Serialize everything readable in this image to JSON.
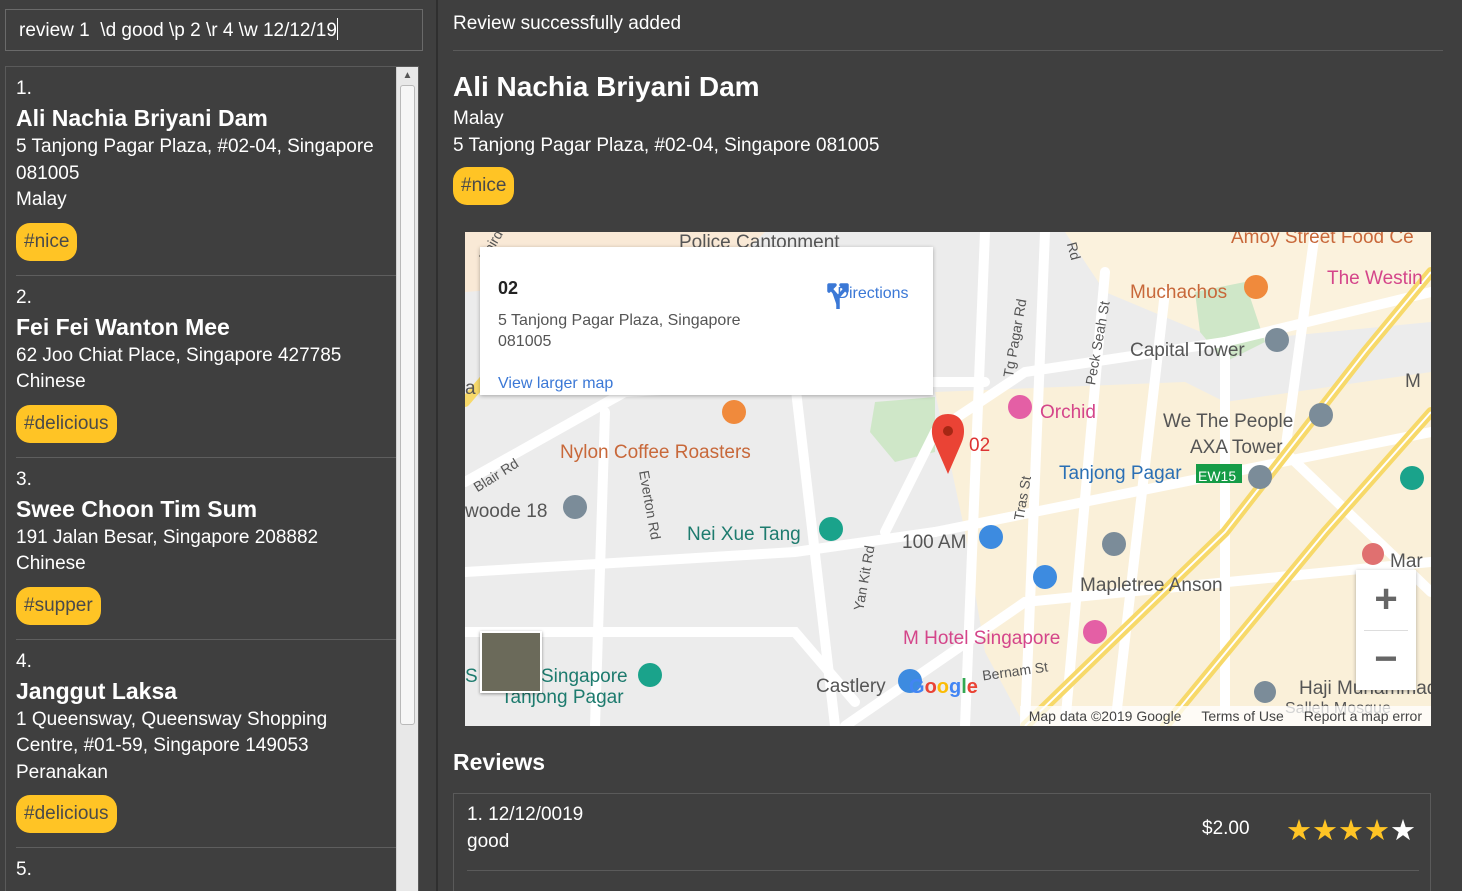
{
  "command_input": {
    "value": "review 1  \\d good \\p 2 \\r 4 \\w 12/12/19"
  },
  "restaurants": [
    {
      "index": "1.",
      "name": "Ali Nachia Briyani Dam",
      "address": "5 Tanjong Pagar Plaza, #02-04, Singapore 081005",
      "address_lines": [
        "5 Tanjong Pagar Plaza, #02-04, Singapore",
        "081005"
      ],
      "cuisine": "Malay",
      "tag": "#nice"
    },
    {
      "index": "2.",
      "name": "Fei Fei Wanton Mee",
      "address": "62 Joo Chiat Place, Singapore 427785",
      "address_lines": [
        "62 Joo Chiat Place, Singapore 427785"
      ],
      "cuisine": "Chinese",
      "tag": "#delicious"
    },
    {
      "index": "3.",
      "name": "Swee Choon Tim Sum",
      "address": "191 Jalan Besar, Singapore 208882",
      "address_lines": [
        "191 Jalan Besar, Singapore 208882"
      ],
      "cuisine": "Chinese",
      "tag": "#supper"
    },
    {
      "index": "4.",
      "name": "Janggut Laksa",
      "address": "1 Queensway, Queensway Shopping Centre, #01-59, Singapore 149053",
      "address_lines": [
        "1 Queensway, Queensway Shopping",
        "Centre, #01-59, Singapore 149053"
      ],
      "cuisine": "Peranakan",
      "tag": "#delicious"
    },
    {
      "index": "5.",
      "name": "",
      "address": "",
      "address_lines": [],
      "cuisine": "",
      "tag": ""
    }
  ],
  "result": {
    "message": "Review successfully added"
  },
  "detail": {
    "name": "Ali Nachia Briyani Dam",
    "cuisine": "Malay",
    "address": "5 Tanjong Pagar Plaza, #02-04, Singapore 081005",
    "tag": "#nice"
  },
  "map": {
    "info_card": {
      "title": "02",
      "address": "5 Tanjong Pagar Plaza, Singapore 081005",
      "directions": "Directions",
      "view_larger": "View larger map"
    },
    "marker_label": "02",
    "labels": {
      "police": "Police Cantonment",
      "amoy": "Amoy Street Food Ce",
      "muchachos": "Muchachos",
      "westin": "The Westin",
      "capital_tower": "Capital Tower",
      "orchid": "Orchid",
      "we_the_people": "We The People",
      "axa_tower": "AXA Tower",
      "tanjong_pagar": "Tanjong Pagar",
      "ew15": "EW15",
      "nylon": "Nylon Coffee Roasters",
      "nei_xue_tang": "Nei Xue Tang",
      "hundred_am": "100 AM",
      "mapletree": "Mapletree Anson",
      "m_hotel": "M Hotel Singapore",
      "castlery": "Castlery",
      "singapore_tp": "Singapore",
      "tanjong_pagar_2": "Tanjong Pagar",
      "woode": "woode 18",
      "haji": "Haji Muhammad",
      "sultan": "Salleh Mosque",
      "mar": "Mar",
      "m_edge": "M",
      "a_edge": "a",
      "s_edge": "S",
      "blair_rd": "Blair Rd",
      "everton_rd": "Everton Rd",
      "yan_kit_rd": "Yan Kit Rd",
      "tg_pagar_rd": "Tg Pagar Rd",
      "peck_seah_st": "Peck Seah St",
      "tras_st": "Tras St",
      "bernam_st": "Bernam St",
      "third_rd": "Third",
      "rd_edge": "Rd"
    },
    "google": "Google",
    "attribution": "Map data ©2019 Google",
    "terms": "Terms of Use",
    "report": "Report a map error",
    "zoom_in": "+",
    "zoom_out": "−"
  },
  "reviews": {
    "heading": "Reviews",
    "items": [
      {
        "index_date": "1. 12/12/0019",
        "text": "good",
        "price": "$2.00",
        "rating": 4,
        "max_rating": 5
      }
    ]
  },
  "colors": {
    "background": "#3f3f3f",
    "tag": "#ffc425",
    "star": "#ffc425",
    "text": "#ffffff"
  },
  "icons": [
    "scroll-up-icon",
    "directions-icon",
    "map-marker-icon",
    "zoom-in-icon",
    "zoom-out-icon",
    "star-icon"
  ]
}
